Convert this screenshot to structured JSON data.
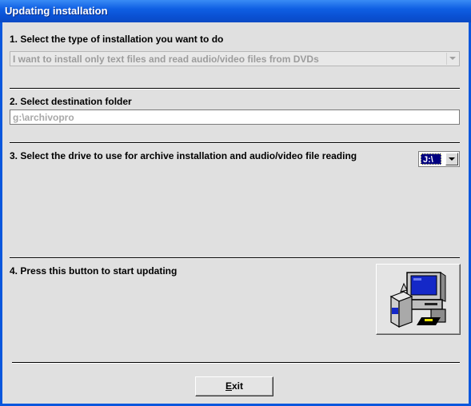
{
  "window": {
    "title": "Updating installation"
  },
  "step1": {
    "label": "1. Select the type of installation you want to do",
    "selected": "I want to install only text files and read audio/video files from DVDs"
  },
  "step2": {
    "label": "2. Select destination folder",
    "value": "g:\\archivopro"
  },
  "step3": {
    "label": "3. Select the drive to use for archive installation and audio/video file reading",
    "drive": "J:\\"
  },
  "step4": {
    "label": "4. Press this button to start updating",
    "icon": "computer-install-icon"
  },
  "exit": {
    "mnemonic": "E",
    "rest": "xit"
  },
  "colors": {
    "titlebar": "#0a57dd",
    "client": "#e0e0e0",
    "highlight": "#000080"
  }
}
